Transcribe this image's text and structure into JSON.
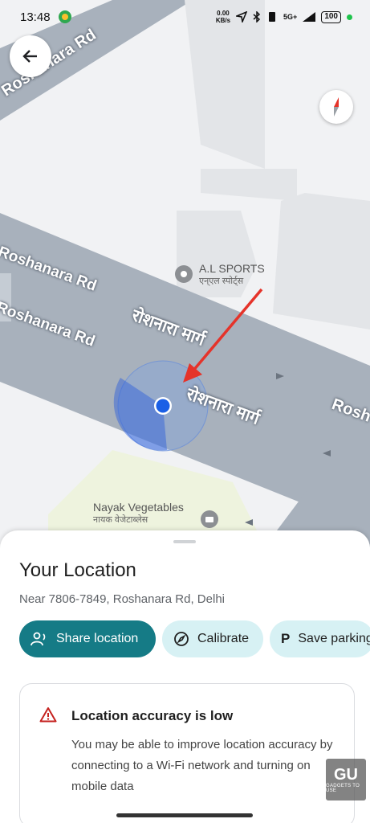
{
  "status_bar": {
    "time": "13:48",
    "speed_value": "0.00",
    "speed_unit": "KB/s",
    "network": "5G+",
    "battery": "100"
  },
  "map": {
    "road_labels": [
      "Roshanara Rd",
      "Roshanara Rd",
      "Roshanara Rd",
      "रोशनारा मार्ग",
      "रोशनारा मार्ग",
      "Rosh"
    ],
    "poi": [
      {
        "name": "A.L SPORTS",
        "sub": "एन्एल स्पोर्ट्स"
      },
      {
        "name": "Nayak Vegetables",
        "sub": "नायक वेजेटाब्लेस"
      }
    ],
    "colors": {
      "road": "#a8b1bc",
      "building": "#e3e5e8",
      "green": "#eef3de",
      "location_dot": "#1a5fe6",
      "arrow": "#e5332a"
    }
  },
  "sheet": {
    "title": "Your Location",
    "address": "Near 7806-7849, Roshanara Rd, Delhi",
    "chips": [
      {
        "label": "Share location",
        "icon": "share-person-icon"
      },
      {
        "label": "Calibrate",
        "icon": "compass-icon"
      },
      {
        "label": "Save parking",
        "icon": "parking-icon"
      }
    ],
    "alert": {
      "title": "Location accuracy is low",
      "body": "You may be able to improve location accuracy by connecting to a Wi-Fi network and turning on mobile data"
    }
  },
  "watermark": {
    "logo": "GU",
    "sub": "GADGETS TO USE"
  }
}
